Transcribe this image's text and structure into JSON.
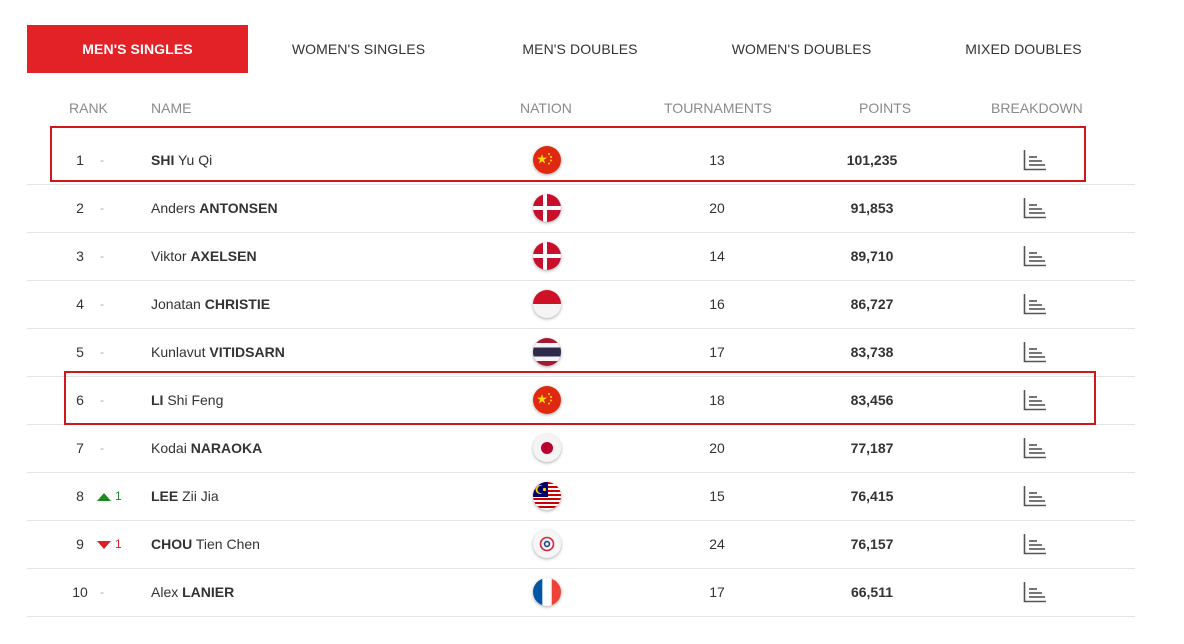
{
  "tabs": [
    {
      "label": "MEN'S SINGLES",
      "active": true
    },
    {
      "label": "WOMEN'S SINGLES",
      "active": false
    },
    {
      "label": "MEN'S DOUBLES",
      "active": false
    },
    {
      "label": "WOMEN'S DOUBLES",
      "active": false
    },
    {
      "label": "MIXED DOUBLES",
      "active": false
    }
  ],
  "headers": {
    "rank": "RANK",
    "name": "NAME",
    "nation": "NATION",
    "tournaments": "TOURNAMENTS",
    "points": "POINTS",
    "breakdown": "BREAKDOWN"
  },
  "rows": [
    {
      "rank": "1",
      "change_dir": "none",
      "change": "-",
      "first": "SHI",
      "rest": " Yu Qi",
      "surname_first": true,
      "flag": "china-flag-icon",
      "tournaments": "13",
      "points": "101,235",
      "highlighted": true
    },
    {
      "rank": "2",
      "change_dir": "none",
      "change": "-",
      "first": "Anders ",
      "rest": "ANTONSEN",
      "surname_first": false,
      "flag": "denmark-flag-icon",
      "tournaments": "20",
      "points": "91,853",
      "highlighted": false
    },
    {
      "rank": "3",
      "change_dir": "none",
      "change": "-",
      "first": "Viktor ",
      "rest": "AXELSEN",
      "surname_first": false,
      "flag": "denmark-flag-icon",
      "tournaments": "14",
      "points": "89,710",
      "highlighted": false
    },
    {
      "rank": "4",
      "change_dir": "none",
      "change": "-",
      "first": "Jonatan ",
      "rest": "CHRISTIE",
      "surname_first": false,
      "flag": "indonesia-flag-icon",
      "tournaments": "16",
      "points": "86,727",
      "highlighted": false
    },
    {
      "rank": "5",
      "change_dir": "none",
      "change": "-",
      "first": "Kunlavut ",
      "rest": "VITIDSARN",
      "surname_first": false,
      "flag": "thailand-flag-icon",
      "tournaments": "17",
      "points": "83,738",
      "highlighted": false
    },
    {
      "rank": "6",
      "change_dir": "none",
      "change": "-",
      "first": "LI",
      "rest": " Shi Feng",
      "surname_first": true,
      "flag": "china-flag-icon",
      "tournaments": "18",
      "points": "83,456",
      "highlighted": true
    },
    {
      "rank": "7",
      "change_dir": "none",
      "change": "-",
      "first": "Kodai ",
      "rest": "NARAOKA",
      "surname_first": false,
      "flag": "japan-flag-icon",
      "tournaments": "20",
      "points": "77,187",
      "highlighted": false
    },
    {
      "rank": "8",
      "change_dir": "up",
      "change": "1",
      "first": "LEE",
      "rest": " Zii Jia",
      "surname_first": true,
      "flag": "malaysia-flag-icon",
      "tournaments": "15",
      "points": "76,415",
      "highlighted": false
    },
    {
      "rank": "9",
      "change_dir": "down",
      "change": "1",
      "first": "CHOU",
      "rest": " Tien Chen",
      "surname_first": true,
      "flag": "chinese-taipei-flag-icon",
      "tournaments": "24",
      "points": "76,157",
      "highlighted": false
    },
    {
      "rank": "10",
      "change_dir": "none",
      "change": "-",
      "first": "Alex ",
      "rest": "LANIER",
      "surname_first": false,
      "flag": "france-flag-icon",
      "tournaments": "17",
      "points": "66,511",
      "highlighted": false
    }
  ],
  "icons": {
    "breakdown": "bar-chart-icon"
  },
  "colors": {
    "accent": "#e32228",
    "highlight_border": "#d0171e",
    "up": "#1e8a1e",
    "down": "#d92128"
  }
}
